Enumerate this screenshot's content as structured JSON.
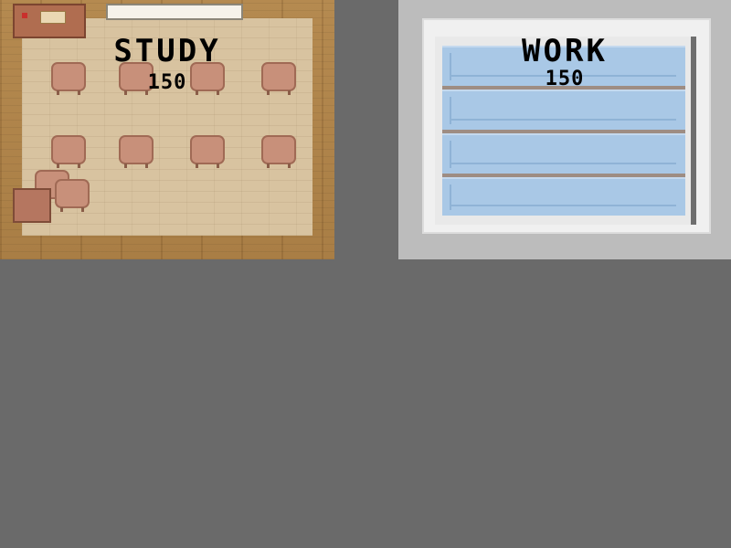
{
  "rooms": {
    "study": {
      "title": "STUDY",
      "count": "150"
    },
    "work": {
      "title": "WORK",
      "count": "150"
    }
  },
  "colors": {
    "background": "#6a6a6a",
    "study_wood": "#b58a50",
    "study_floor": "#d8c3a0",
    "chair": "#c8907a",
    "work_wall": "#bcbcbc",
    "window_glass": "#a9c8e6",
    "text": "#000000"
  }
}
